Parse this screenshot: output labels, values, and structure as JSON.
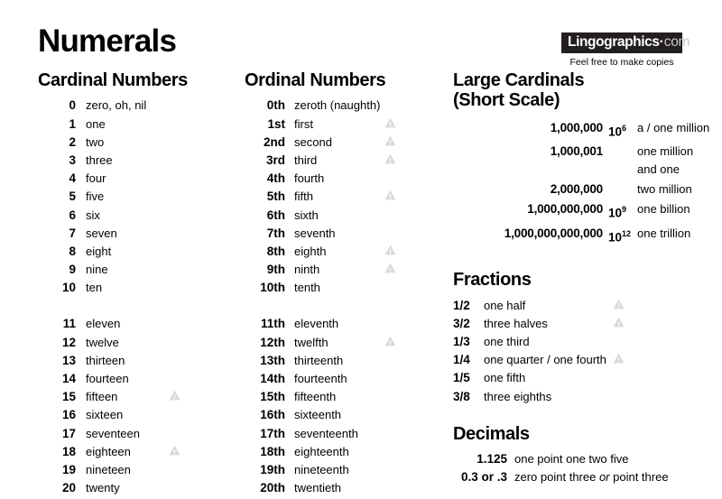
{
  "page": {
    "title": "Numerals",
    "icon_name": "audio-warning-triangle-icon",
    "icon_color": "#d9d9d9"
  },
  "logo": {
    "name": "Lingographics",
    "separator": "·",
    "tld": "com",
    "tagline": "Feel free to make copies",
    "box_color": "#231f20"
  },
  "cardinal": {
    "heading": "Cardinal Numbers",
    "rows_a": [
      {
        "num": "0",
        "word": "zero, oh, nil",
        "icon": false
      },
      {
        "num": "1",
        "word": "one",
        "icon": false
      },
      {
        "num": "2",
        "word": "two",
        "icon": false
      },
      {
        "num": "3",
        "word": "three",
        "icon": false
      },
      {
        "num": "4",
        "word": "four",
        "icon": false
      },
      {
        "num": "5",
        "word": "five",
        "icon": false
      },
      {
        "num": "6",
        "word": "six",
        "icon": false
      },
      {
        "num": "7",
        "word": "seven",
        "icon": false
      },
      {
        "num": "8",
        "word": "eight",
        "icon": false
      },
      {
        "num": "9",
        "word": "nine",
        "icon": false
      },
      {
        "num": "10",
        "word": "ten",
        "icon": false
      }
    ],
    "rows_b": [
      {
        "num": "11",
        "word": "eleven",
        "icon": false
      },
      {
        "num": "12",
        "word": "twelve",
        "icon": false
      },
      {
        "num": "13",
        "word": "thirteen",
        "icon": false
      },
      {
        "num": "14",
        "word": "fourteen",
        "icon": false
      },
      {
        "num": "15",
        "word": "fifteen",
        "icon": true
      },
      {
        "num": "16",
        "word": "sixteen",
        "icon": false
      },
      {
        "num": "17",
        "word": "seventeen",
        "icon": false
      },
      {
        "num": "18",
        "word": "eighteen",
        "icon": true
      },
      {
        "num": "19",
        "word": "nineteen",
        "icon": false
      },
      {
        "num": "20",
        "word": "twenty",
        "icon": false
      }
    ]
  },
  "ordinal": {
    "heading": "Ordinal Numbers",
    "rows_a": [
      {
        "num": "0th",
        "word": "zeroth (naughth)",
        "icon": false
      },
      {
        "num": "1st",
        "word": "first",
        "icon": true
      },
      {
        "num": "2nd",
        "word": "second",
        "icon": true
      },
      {
        "num": "3rd",
        "word": "third",
        "icon": true
      },
      {
        "num": "4th",
        "word": "fourth",
        "icon": false
      },
      {
        "num": "5th",
        "word": "fifth",
        "icon": true
      },
      {
        "num": "6th",
        "word": "sixth",
        "icon": false
      },
      {
        "num": "7th",
        "word": "seventh",
        "icon": false
      },
      {
        "num": "8th",
        "word": "eighth",
        "icon": true
      },
      {
        "num": "9th",
        "word": "ninth",
        "icon": true
      },
      {
        "num": "10th",
        "word": "tenth",
        "icon": false
      }
    ],
    "rows_b": [
      {
        "num": "11th",
        "word": "eleventh",
        "icon": false
      },
      {
        "num": "12th",
        "word": "twelfth",
        "icon": true
      },
      {
        "num": "13th",
        "word": "thirteenth",
        "icon": false
      },
      {
        "num": "14th",
        "word": "fourteenth",
        "icon": false
      },
      {
        "num": "15th",
        "word": "fifteenth",
        "icon": false
      },
      {
        "num": "16th",
        "word": "sixteenth",
        "icon": false
      },
      {
        "num": "17th",
        "word": "seventeenth",
        "icon": false
      },
      {
        "num": "18th",
        "word": "eighteenth",
        "icon": false
      },
      {
        "num": "19th",
        "word": "nineteenth",
        "icon": false
      },
      {
        "num": "20th",
        "word": "twentieth",
        "icon": false
      }
    ]
  },
  "large_cardinals": {
    "heading_line1": "Large Cardinals",
    "heading_line2": "(Short Scale)",
    "rows": [
      {
        "num": "1,000,000",
        "base": "10",
        "exp": "6",
        "word": "a / one million"
      },
      {
        "num": "1,000,001",
        "base": "",
        "exp": "",
        "word": "one million and one"
      },
      {
        "num": "2,000,000",
        "base": "",
        "exp": "",
        "word": "two million"
      },
      {
        "num": "1,000,000,000",
        "base": "10",
        "exp": "9",
        "word": "one billion"
      },
      {
        "num": "1,000,000,000,000",
        "base": "10",
        "exp": "12",
        "word": "one trillion"
      }
    ]
  },
  "fractions": {
    "heading": "Fractions",
    "rows": [
      {
        "num": "1/2",
        "word": "one half",
        "icon": true
      },
      {
        "num": "3/2",
        "word": "three halves",
        "icon": true
      },
      {
        "num": "1/3",
        "word": "one third",
        "icon": false
      },
      {
        "num": "1/4",
        "word": "one quarter / one fourth",
        "icon": true
      },
      {
        "num": "1/5",
        "word": "one fifth",
        "icon": false
      },
      {
        "num": "3/8",
        "word": "three eighths",
        "icon": false
      }
    ]
  },
  "decimals": {
    "heading": "Decimals",
    "rows": [
      {
        "num": "1.125",
        "word_pre": "one point one two five",
        "word_em": "",
        "word_post": ""
      },
      {
        "num": "0.3 or .3",
        "word_pre": "zero point three ",
        "word_em": "or",
        "word_post": " point three"
      }
    ]
  }
}
